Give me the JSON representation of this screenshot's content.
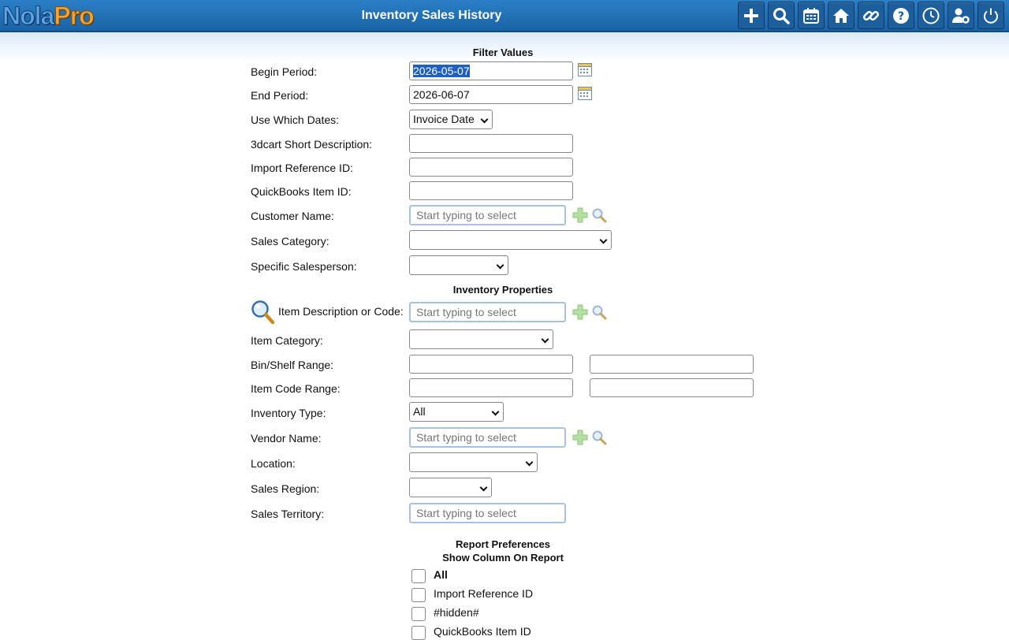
{
  "header": {
    "logo_nola": "Nola",
    "logo_pro": "Pro",
    "title": "Inventory Sales History",
    "toolbar": [
      {
        "name": "add-button",
        "icon": "plus-icon"
      },
      {
        "name": "search-button",
        "icon": "search-icon"
      },
      {
        "name": "calendar-button",
        "icon": "calendar-icon"
      },
      {
        "name": "home-button",
        "icon": "home-icon"
      },
      {
        "name": "links-button",
        "icon": "link-icon"
      },
      {
        "name": "help-button",
        "icon": "help-icon"
      },
      {
        "name": "time-button",
        "icon": "clock-icon"
      },
      {
        "name": "user-settings-button",
        "icon": "user-gear-icon"
      },
      {
        "name": "logout-button",
        "icon": "power-icon"
      }
    ]
  },
  "filter": {
    "section_title": "Filter Values",
    "begin_period": {
      "label": "Begin Period:",
      "value": "2026-05-07"
    },
    "end_period": {
      "label": "End Period:",
      "value": "2026-06-07"
    },
    "use_which_dates": {
      "label": "Use Which Dates:",
      "value": "Invoice Date"
    },
    "short_description": {
      "label": "3dcart Short Description:",
      "value": ""
    },
    "import_reference": {
      "label": "Import Reference ID:",
      "value": ""
    },
    "quickbooks_item": {
      "label": "QuickBooks Item ID:",
      "value": ""
    },
    "customer_name": {
      "label": "Customer Name:",
      "placeholder": "Start typing to select"
    },
    "sales_category": {
      "label": "Sales Category:",
      "value": ""
    },
    "salesperson": {
      "label": "Specific Salesperson:",
      "value": ""
    }
  },
  "inventory": {
    "section_title": "Inventory Properties",
    "item_description": {
      "label": "Item Description or Code:",
      "placeholder": "Start typing to select"
    },
    "item_category": {
      "label": "Item Category:",
      "value": ""
    },
    "bin_shelf": {
      "label": "Bin/Shelf Range:"
    },
    "item_code": {
      "label": "Item Code Range:"
    },
    "inventory_type": {
      "label": "Inventory Type:",
      "value": "All"
    },
    "vendor_name": {
      "label": "Vendor Name:",
      "placeholder": "Start typing to select"
    },
    "location": {
      "label": "Location:",
      "value": ""
    },
    "sales_region": {
      "label": "Sales Region:",
      "value": ""
    },
    "sales_territory": {
      "label": "Sales Territory:",
      "placeholder": "Start typing to select"
    }
  },
  "preferences": {
    "section_title": "Report Preferences",
    "subtitle": "Show Column On Report",
    "columns": [
      "All",
      "Import Reference ID",
      "#hidden#",
      "QuickBooks Item ID"
    ]
  }
}
